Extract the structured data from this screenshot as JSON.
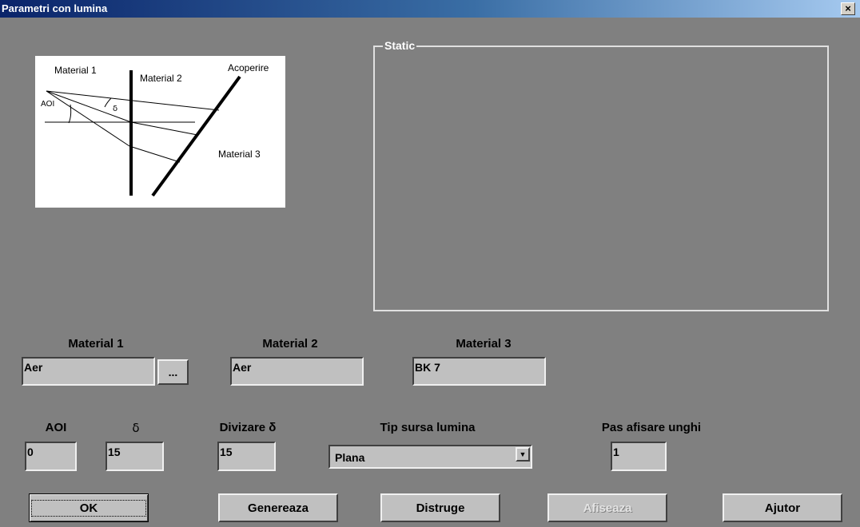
{
  "window": {
    "title": "Parametri con lumina",
    "close_label": "×"
  },
  "diagram": {
    "material1": "Material 1",
    "material2": "Material 2",
    "coating": "Acoperire",
    "material3": "Material 3",
    "aoi": "AOI",
    "delta": "δ"
  },
  "static_group": {
    "label": "Static"
  },
  "materials": {
    "m1": {
      "label": "Material 1",
      "value": "Aer",
      "browse_label": "..."
    },
    "m2": {
      "label": "Material 2",
      "value": "Aer"
    },
    "m3": {
      "label": "Material 3",
      "value": "BK 7"
    }
  },
  "params": {
    "aoi": {
      "label": "AOI",
      "value": "0"
    },
    "delta": {
      "label": "δ",
      "value": "15"
    },
    "divizare": {
      "label": "Divizare δ",
      "value": "15"
    },
    "source": {
      "label": "Tip sursa lumina",
      "value": "Plana"
    },
    "pas": {
      "label": "Pas afisare unghi",
      "value": "1"
    }
  },
  "buttons": {
    "ok": "OK",
    "genereaza": "Genereaza",
    "distruge": "Distruge",
    "afiseaza": "Afiseaza",
    "ajutor": "Ajutor"
  }
}
